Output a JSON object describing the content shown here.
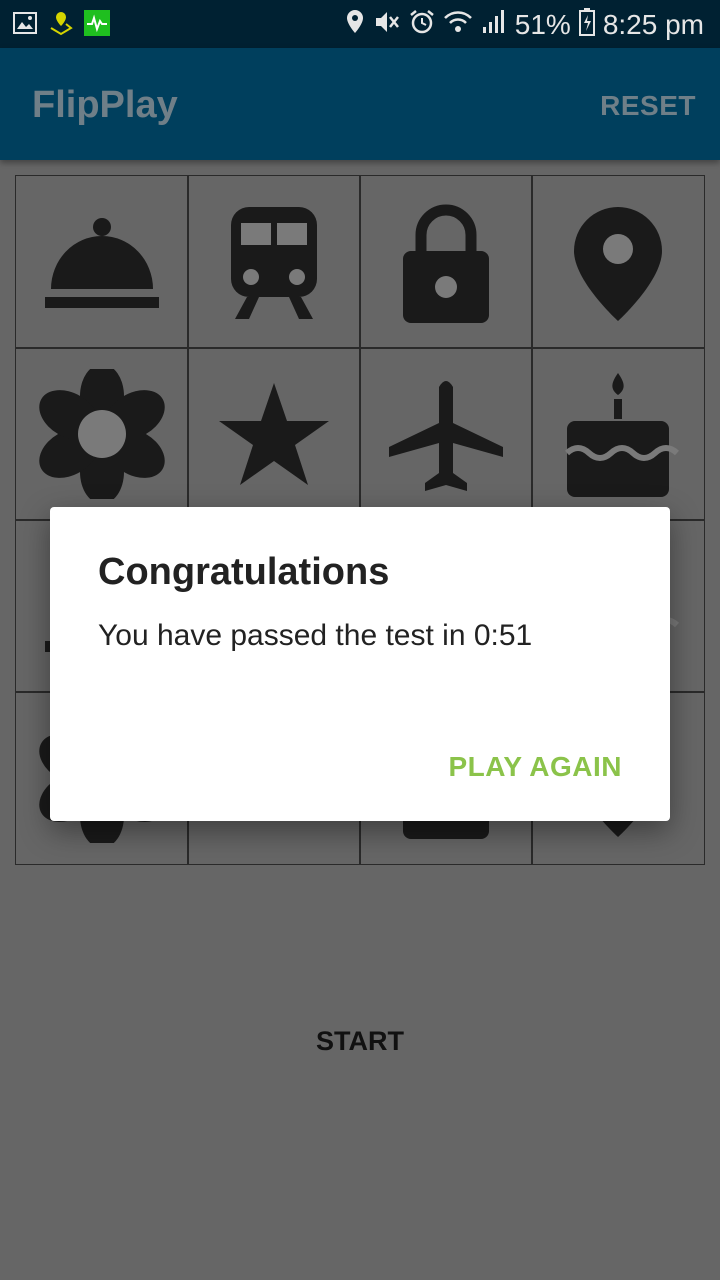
{
  "status_bar": {
    "battery": "51%",
    "time": "8:25 pm",
    "icons": [
      "gallery-icon",
      "map-pin-icon",
      "health-icon",
      "location-icon",
      "mute-icon",
      "alarm-icon",
      "wifi-icon",
      "signal-icon",
      "battery-icon"
    ]
  },
  "app_bar": {
    "title": "FlipPlay",
    "reset_label": "RESET"
  },
  "grid": {
    "tiles": [
      "cloche-icon",
      "train-icon",
      "lock-icon",
      "map-pin-icon",
      "flower-icon",
      "star-icon",
      "airplane-icon",
      "cake-icon"
    ]
  },
  "start_label": "START",
  "dialog": {
    "title": "Congratulations",
    "message": "You have passed the test in 0:51",
    "button_label": "PLAY AGAIN"
  },
  "colors": {
    "app_bar": "#003f5d",
    "status_bar": "#002132",
    "overlay": "#666666",
    "accent": "#8bc34a"
  }
}
